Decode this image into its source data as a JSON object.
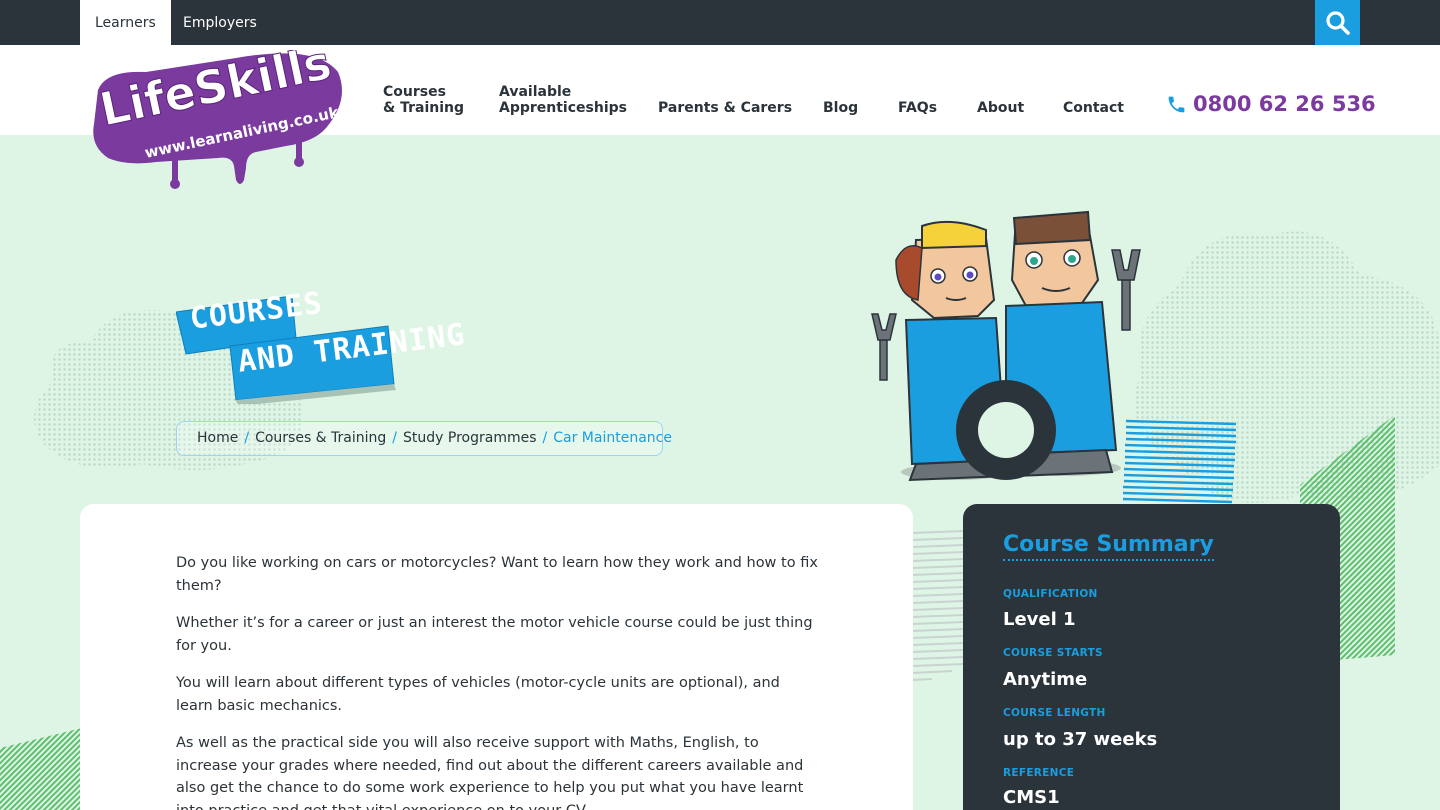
{
  "top_tabs": [
    "Learners",
    "Employers"
  ],
  "logo": {
    "brand": "LifeSkills",
    "url_text": "www.learnaliving.co.uk"
  },
  "nav": {
    "courses_line1": "Courses",
    "courses_line2": "& Training",
    "apprent_line1": "Available",
    "apprent_line2": "Apprenticeships",
    "parents": "Parents & Carers",
    "blog": "Blog",
    "faqs": "FAQs",
    "about": "About",
    "contact": "Contact"
  },
  "phone": "0800 62 26 536",
  "hero": {
    "badge_line1": "COURSES",
    "badge_line2": "AND TRAINING"
  },
  "breadcrumb": {
    "items": [
      "Home",
      "Courses & Training",
      "Study Programmes"
    ],
    "current": "Car Maintenance",
    "separator": "/"
  },
  "content": {
    "paragraphs": [
      "Do you like working on cars or motorcycles? Want to learn how they work and how to fix them?",
      "Whether it’s for a career or just an interest the motor vehicle course could be just thing for you.",
      "You will learn about different types of vehicles (motor-cycle units are optional), and learn basic mechanics.",
      "As well as the practical side you will also receive support with Maths, English, to increase your grades where needed, find out about the different careers available and also get the chance to do some work experience to help you put what you have learnt into practice and get that vital experience on to your CV."
    ]
  },
  "summary": {
    "title": "Course Summary",
    "qualification_label": "QUALIFICATION",
    "qualification": "Level 1",
    "starts_label": "COURSE STARTS",
    "starts": "Anytime",
    "length_label": "COURSE LENGTH",
    "length": "up to 37 weeks",
    "reference_label": "REFERENCE",
    "reference": "CMS1"
  },
  "colors": {
    "dark": "#2b343a",
    "accent_blue": "#1a9ee0",
    "brand_purple": "#7b3a9e",
    "background_mint": "#def5e6"
  },
  "icons": [
    "search-icon",
    "phone-icon"
  ]
}
